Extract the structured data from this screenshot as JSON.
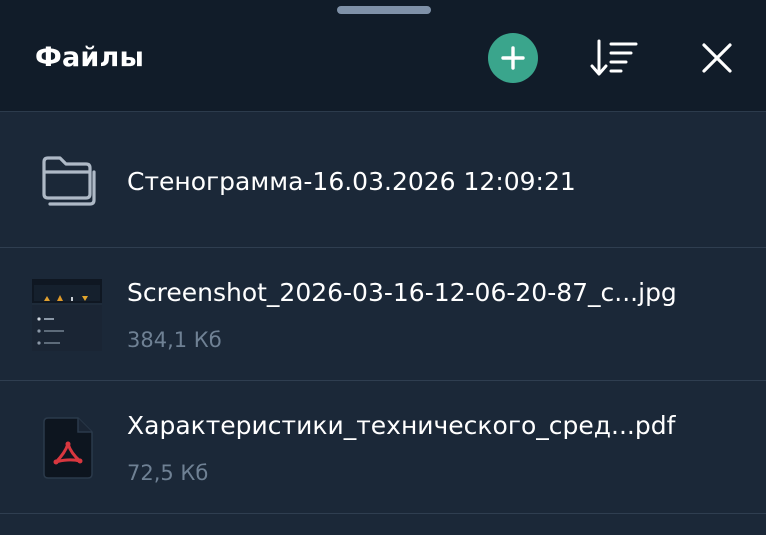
{
  "header": {
    "title": "Файлы",
    "add_icon": "plus-icon",
    "sort_icon": "sort-icon",
    "close_icon": "close-icon"
  },
  "files": [
    {
      "icon": "folder-icon",
      "name": "Стенограмма-16.03.2026 12:09:21",
      "size": ""
    },
    {
      "icon": "image-thumbnail",
      "name": "Screenshot_2026-03-16-12-06-20-87_c...jpg",
      "size": "384,1 Кб"
    },
    {
      "icon": "pdf-icon",
      "name": "Характеристики_технического_сред...pdf",
      "size": "72,5 Кб"
    }
  ],
  "colors": {
    "header_bg": "#111c29",
    "list_bg": "#1b2838",
    "accent": "#3aa58c",
    "pdf_red": "#d8373f",
    "secondary_text": "#6f8194"
  }
}
